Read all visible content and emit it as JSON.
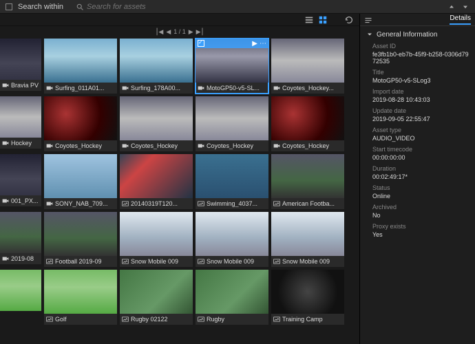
{
  "toolbar": {
    "search_within": "Search within",
    "search_placeholder": "Search for assets"
  },
  "pager": {
    "text": "1 / 1"
  },
  "panel": {
    "tab_details": "Details",
    "section_general": "General Information",
    "fields": {
      "asset_id_label": "Asset ID",
      "asset_id_value": "fe3fb1b0-eb7b-45f9-b258-0306d7972535",
      "title_label": "Title",
      "title_value": "MotoGP50-v5-SLog3",
      "import_label": "Import date",
      "import_value": "2019-08-28 10:43:03",
      "update_label": "Update date",
      "update_value": "2019-09-05 22:55:47",
      "type_label": "Asset type",
      "type_value": "AUDIO_VIDEO",
      "start_tc_label": "Start timecode",
      "start_tc_value": "00:00:00:00",
      "duration_label": "Duration",
      "duration_value": "00:02:49:17*",
      "status_label": "Status",
      "status_value": "Online",
      "archived_label": "Archived",
      "archived_value": "No",
      "proxy_label": "Proxy exists",
      "proxy_value": "Yes"
    }
  },
  "tiles": [
    {
      "name": "Bravia PV",
      "kind": "video",
      "css": "t-port",
      "cut": true
    },
    {
      "name": "Surfing_011A01...",
      "kind": "video",
      "css": "t-surf"
    },
    {
      "name": "Surfing_178A00...",
      "kind": "video",
      "css": "t-surf"
    },
    {
      "name": "MotoGP50-v5-SL...",
      "kind": "video",
      "css": "t-moto",
      "selected": true
    },
    {
      "name": "Coyotes_Hockey...",
      "kind": "video",
      "css": "t-hockey"
    },
    {
      "name": "Hockey",
      "kind": "video",
      "css": "t-hockey",
      "cut": true
    },
    {
      "name": "Coyotes_Hockey",
      "kind": "video",
      "css": "t-hockey2"
    },
    {
      "name": "Coyotes_Hockey",
      "kind": "video",
      "css": "t-hockey"
    },
    {
      "name": "Coyotes_Hockey",
      "kind": "video",
      "css": "t-hockey"
    },
    {
      "name": "Coyotes_Hockey",
      "kind": "video",
      "css": "t-hockey2"
    },
    {
      "name": "001_PX...",
      "kind": "video",
      "css": "t-port",
      "cut": true
    },
    {
      "name": "SONY_NAB_709...",
      "kind": "video",
      "css": "t-car"
    },
    {
      "name": "20140319T120...",
      "kind": "image",
      "css": "t-kayak"
    },
    {
      "name": "Swimming_4037...",
      "kind": "image",
      "css": "t-swim"
    },
    {
      "name": "American Footba...",
      "kind": "image",
      "css": "t-foot"
    },
    {
      "name": "2019-08",
      "kind": "video",
      "css": "t-foot",
      "cut": true
    },
    {
      "name": "Football 2019-09",
      "kind": "image",
      "css": "t-foot"
    },
    {
      "name": "Snow Mobile 009",
      "kind": "image",
      "css": "t-snow"
    },
    {
      "name": "Snow Mobile 009",
      "kind": "image",
      "css": "t-snow"
    },
    {
      "name": "Snow Mobile 009",
      "kind": "image",
      "css": "t-snow"
    },
    {
      "name": "",
      "kind": "",
      "css": "t-golf",
      "cut": true
    },
    {
      "name": "Golf",
      "kind": "image",
      "css": "t-golf"
    },
    {
      "name": "Rugby 02122",
      "kind": "image",
      "css": "t-rugby"
    },
    {
      "name": "Rugby",
      "kind": "image",
      "css": "t-rugby"
    },
    {
      "name": "Training Camp",
      "kind": "image",
      "css": "t-dark"
    }
  ]
}
